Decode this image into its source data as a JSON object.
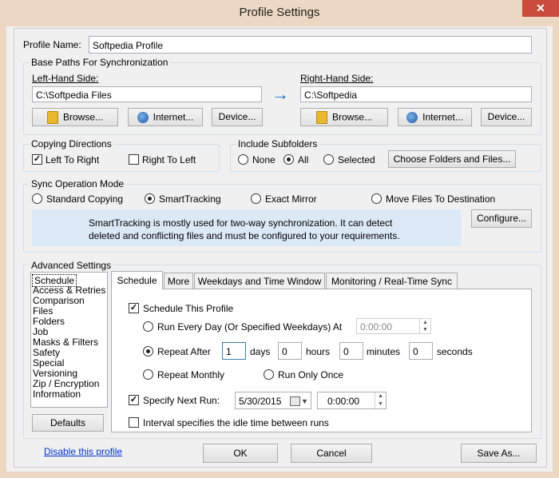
{
  "window": {
    "title": "Profile Settings",
    "close_glyph": "✕"
  },
  "profile_name": {
    "label": "Profile Name:",
    "value": "Softpedia Profile"
  },
  "base_paths": {
    "legend": "Base Paths For Synchronization",
    "left": {
      "label": "Left-Hand Side:",
      "value": "C:\\Softpedia Files",
      "browse": "Browse...",
      "internet": "Internet...",
      "device": "Device..."
    },
    "arrow": "→",
    "right": {
      "label": "Right-Hand Side:",
      "value": "C:\\Softpedia",
      "browse": "Browse...",
      "internet": "Internet...",
      "device": "Device..."
    }
  },
  "copying_directions": {
    "legend": "Copying Directions",
    "left_to_right": {
      "label": "Left To Right",
      "checked": true
    },
    "right_to_left": {
      "label": "Right To Left",
      "checked": false
    }
  },
  "include_subfolders": {
    "legend": "Include Subfolders",
    "options": [
      "None",
      "All",
      "Selected"
    ],
    "selected": "All",
    "choose_button": "Choose Folders and Files..."
  },
  "sync_mode": {
    "legend": "Sync Operation Mode",
    "options": [
      "Standard Copying",
      "SmartTracking",
      "Exact Mirror",
      "Move Files To Destination"
    ],
    "selected": "SmartTracking",
    "info_line1": "SmartTracking is mostly used for two-way synchronization. It can detect",
    "info_line2": "deleted and conflicting files and must be configured to your requirements.",
    "configure": "Configure..."
  },
  "advanced": {
    "legend": "Advanced Settings",
    "categories": [
      "Schedule",
      "Access & Retries",
      "Comparison",
      "Files",
      "Folders",
      "Job",
      "Masks & Filters",
      "Safety",
      "Special",
      "Versioning",
      "Zip / Encryption",
      "Information"
    ],
    "selected_category": "Schedule",
    "defaults": "Defaults",
    "tabs": [
      "Schedule",
      "More",
      "Weekdays and Time Window",
      "Monitoring / Real-Time Sync"
    ],
    "active_tab": "Schedule",
    "schedule": {
      "schedule_this_profile": {
        "label": "Schedule This Profile",
        "checked": true
      },
      "run_every_day": {
        "label": "Run Every Day (Or Specified Weekdays) At",
        "time": "0:00:00"
      },
      "repeat_after": {
        "label": "Repeat After",
        "days_value": "1",
        "days": "days",
        "hours_value": "0",
        "hours": "hours",
        "minutes_value": "0",
        "minutes": "minutes",
        "seconds_value": "0",
        "seconds": "seconds"
      },
      "repeat_monthly": "Repeat Monthly",
      "run_only_once": "Run Only Once",
      "selected_option": "Repeat After",
      "specify_next_run": {
        "label": "Specify Next Run:",
        "checked": true,
        "date": "5/30/2015",
        "time": "0:00:00"
      },
      "interval_idle": {
        "label": "Interval specifies the idle time between runs",
        "checked": false
      }
    }
  },
  "footer": {
    "disable_link": "Disable this profile",
    "ok": "OK",
    "cancel": "Cancel",
    "save_as": "Save As..."
  },
  "colors": {
    "title_bar": "#ecd7c2",
    "close_button": "#c94b3b",
    "info_box": "#dbe8f6",
    "link": "#0033cc",
    "arrow": "#1e73c8"
  }
}
